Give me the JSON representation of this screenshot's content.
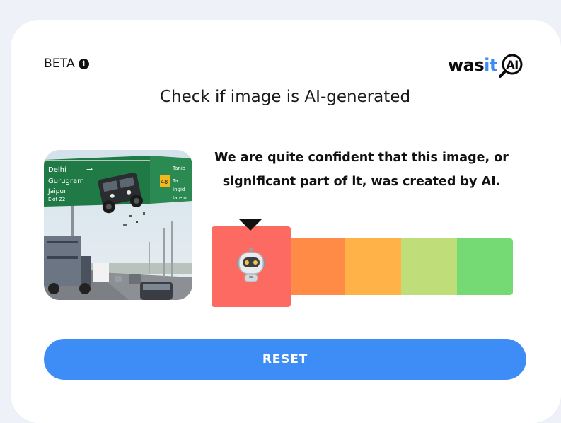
{
  "header": {
    "beta_label": "BETA",
    "info_icon": "info-icon",
    "logo": {
      "text_main": "was",
      "text_accent": "it",
      "badge": "AI",
      "accent_color": "#3d8bf6"
    }
  },
  "main": {
    "title": "Check if image is AI-generated",
    "image_signs": [
      "Delhi",
      "Gurugram",
      "Jaipur",
      "Exit 22",
      "48",
      "Tanio",
      "Ta",
      "Ingid",
      "Iareio"
    ],
    "verdict_line1": "We are quite confident that this image, or",
    "verdict_line2": "significant part of it, was created by AI.",
    "meter": {
      "segments": [
        "#fc6a62",
        "#ff8b47",
        "#ffb247",
        "#bfdd78",
        "#76da74"
      ],
      "selected_index": 0,
      "selected_icon": "robot-icon"
    }
  },
  "footer": {
    "reset_label": "RESET",
    "button_color": "#3e8df6"
  }
}
